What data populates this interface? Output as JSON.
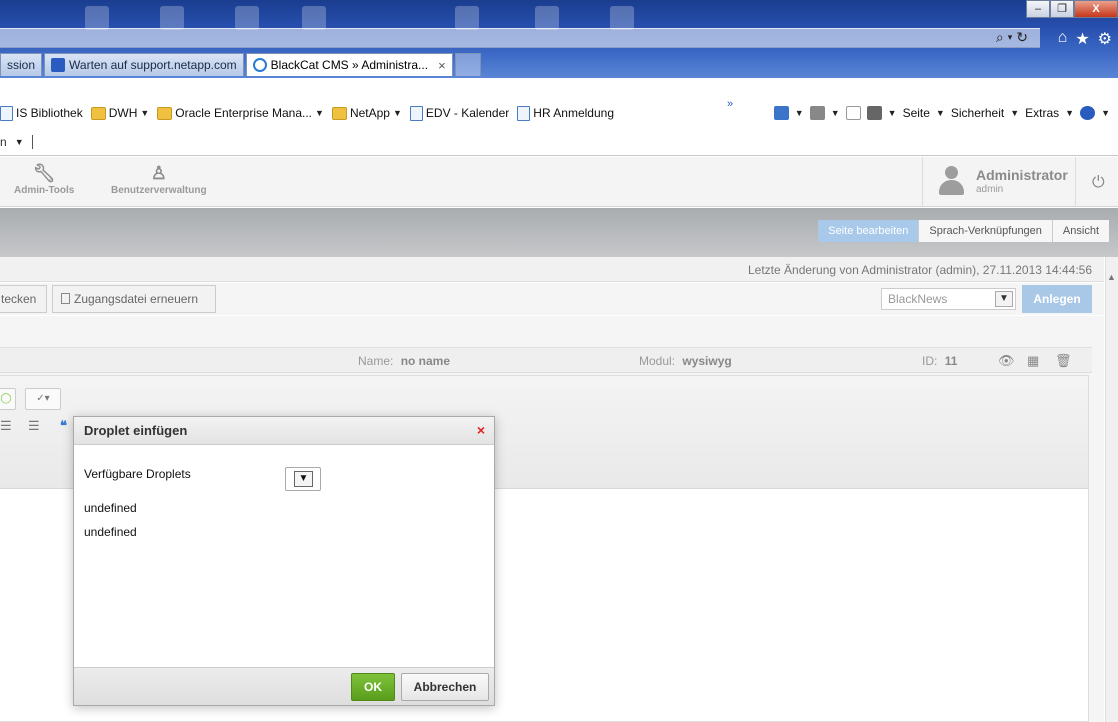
{
  "browser": {
    "tabs": [
      {
        "label": "ssion"
      },
      {
        "label": "Warten auf support.netapp.com"
      },
      {
        "label": "BlackCat CMS » Administra..."
      }
    ],
    "tab_close": "×",
    "window_buttons": {
      "minimize": "–",
      "restore": "❐",
      "close": "X"
    },
    "favorites": [
      {
        "label": "IS Bibliothek",
        "icon": "page-icon"
      },
      {
        "label": "DWH",
        "icon": "folder-icon"
      },
      {
        "label": "Oracle Enterprise Mana...",
        "icon": "folder-icon"
      },
      {
        "label": "NetApp",
        "icon": "folder-icon"
      },
      {
        "label": "EDV - Kalender",
        "icon": "page-icon"
      },
      {
        "label": "HR Anmeldung",
        "icon": "page-icon"
      }
    ],
    "more_chevron": "»",
    "commands": {
      "page": "Seite",
      "safety": "Sicherheit",
      "extras": "Extras"
    },
    "row2_label": "n"
  },
  "cms": {
    "tools": [
      {
        "label": "Admin-Tools",
        "icon": "wrench-icon"
      },
      {
        "label": "Benutzerverwaltung",
        "icon": "users-icon"
      }
    ],
    "user": {
      "name": "Administrator",
      "login": "admin"
    },
    "page_tabs": [
      {
        "label": "Seite bearbeiten",
        "active": true
      },
      {
        "label": "Sprach-Verknüpfungen",
        "active": false
      },
      {
        "label": "Ansicht",
        "active": false
      }
    ],
    "last_change": "Letzte Änderung von Administrator (admin), 27.11.2013 14:44:56",
    "toolbar": {
      "hide_label": "tecken",
      "renew_label": "Zugangsdatei erneuern",
      "module_select": "BlackNews",
      "create_label": "Anlegen"
    },
    "section": {
      "name_label": "Name:",
      "name_value": "no name",
      "module_label": "Modul:",
      "module_value": "wysiwyg",
      "id_label": "ID:",
      "id_value": "11"
    }
  },
  "dialog": {
    "title": "Droplet einfügen",
    "close": "×",
    "available_label": "Verfügbare Droplets",
    "lines": [
      "undefined",
      "undefined"
    ],
    "ok_label": "OK",
    "cancel_label": "Abbrechen"
  }
}
